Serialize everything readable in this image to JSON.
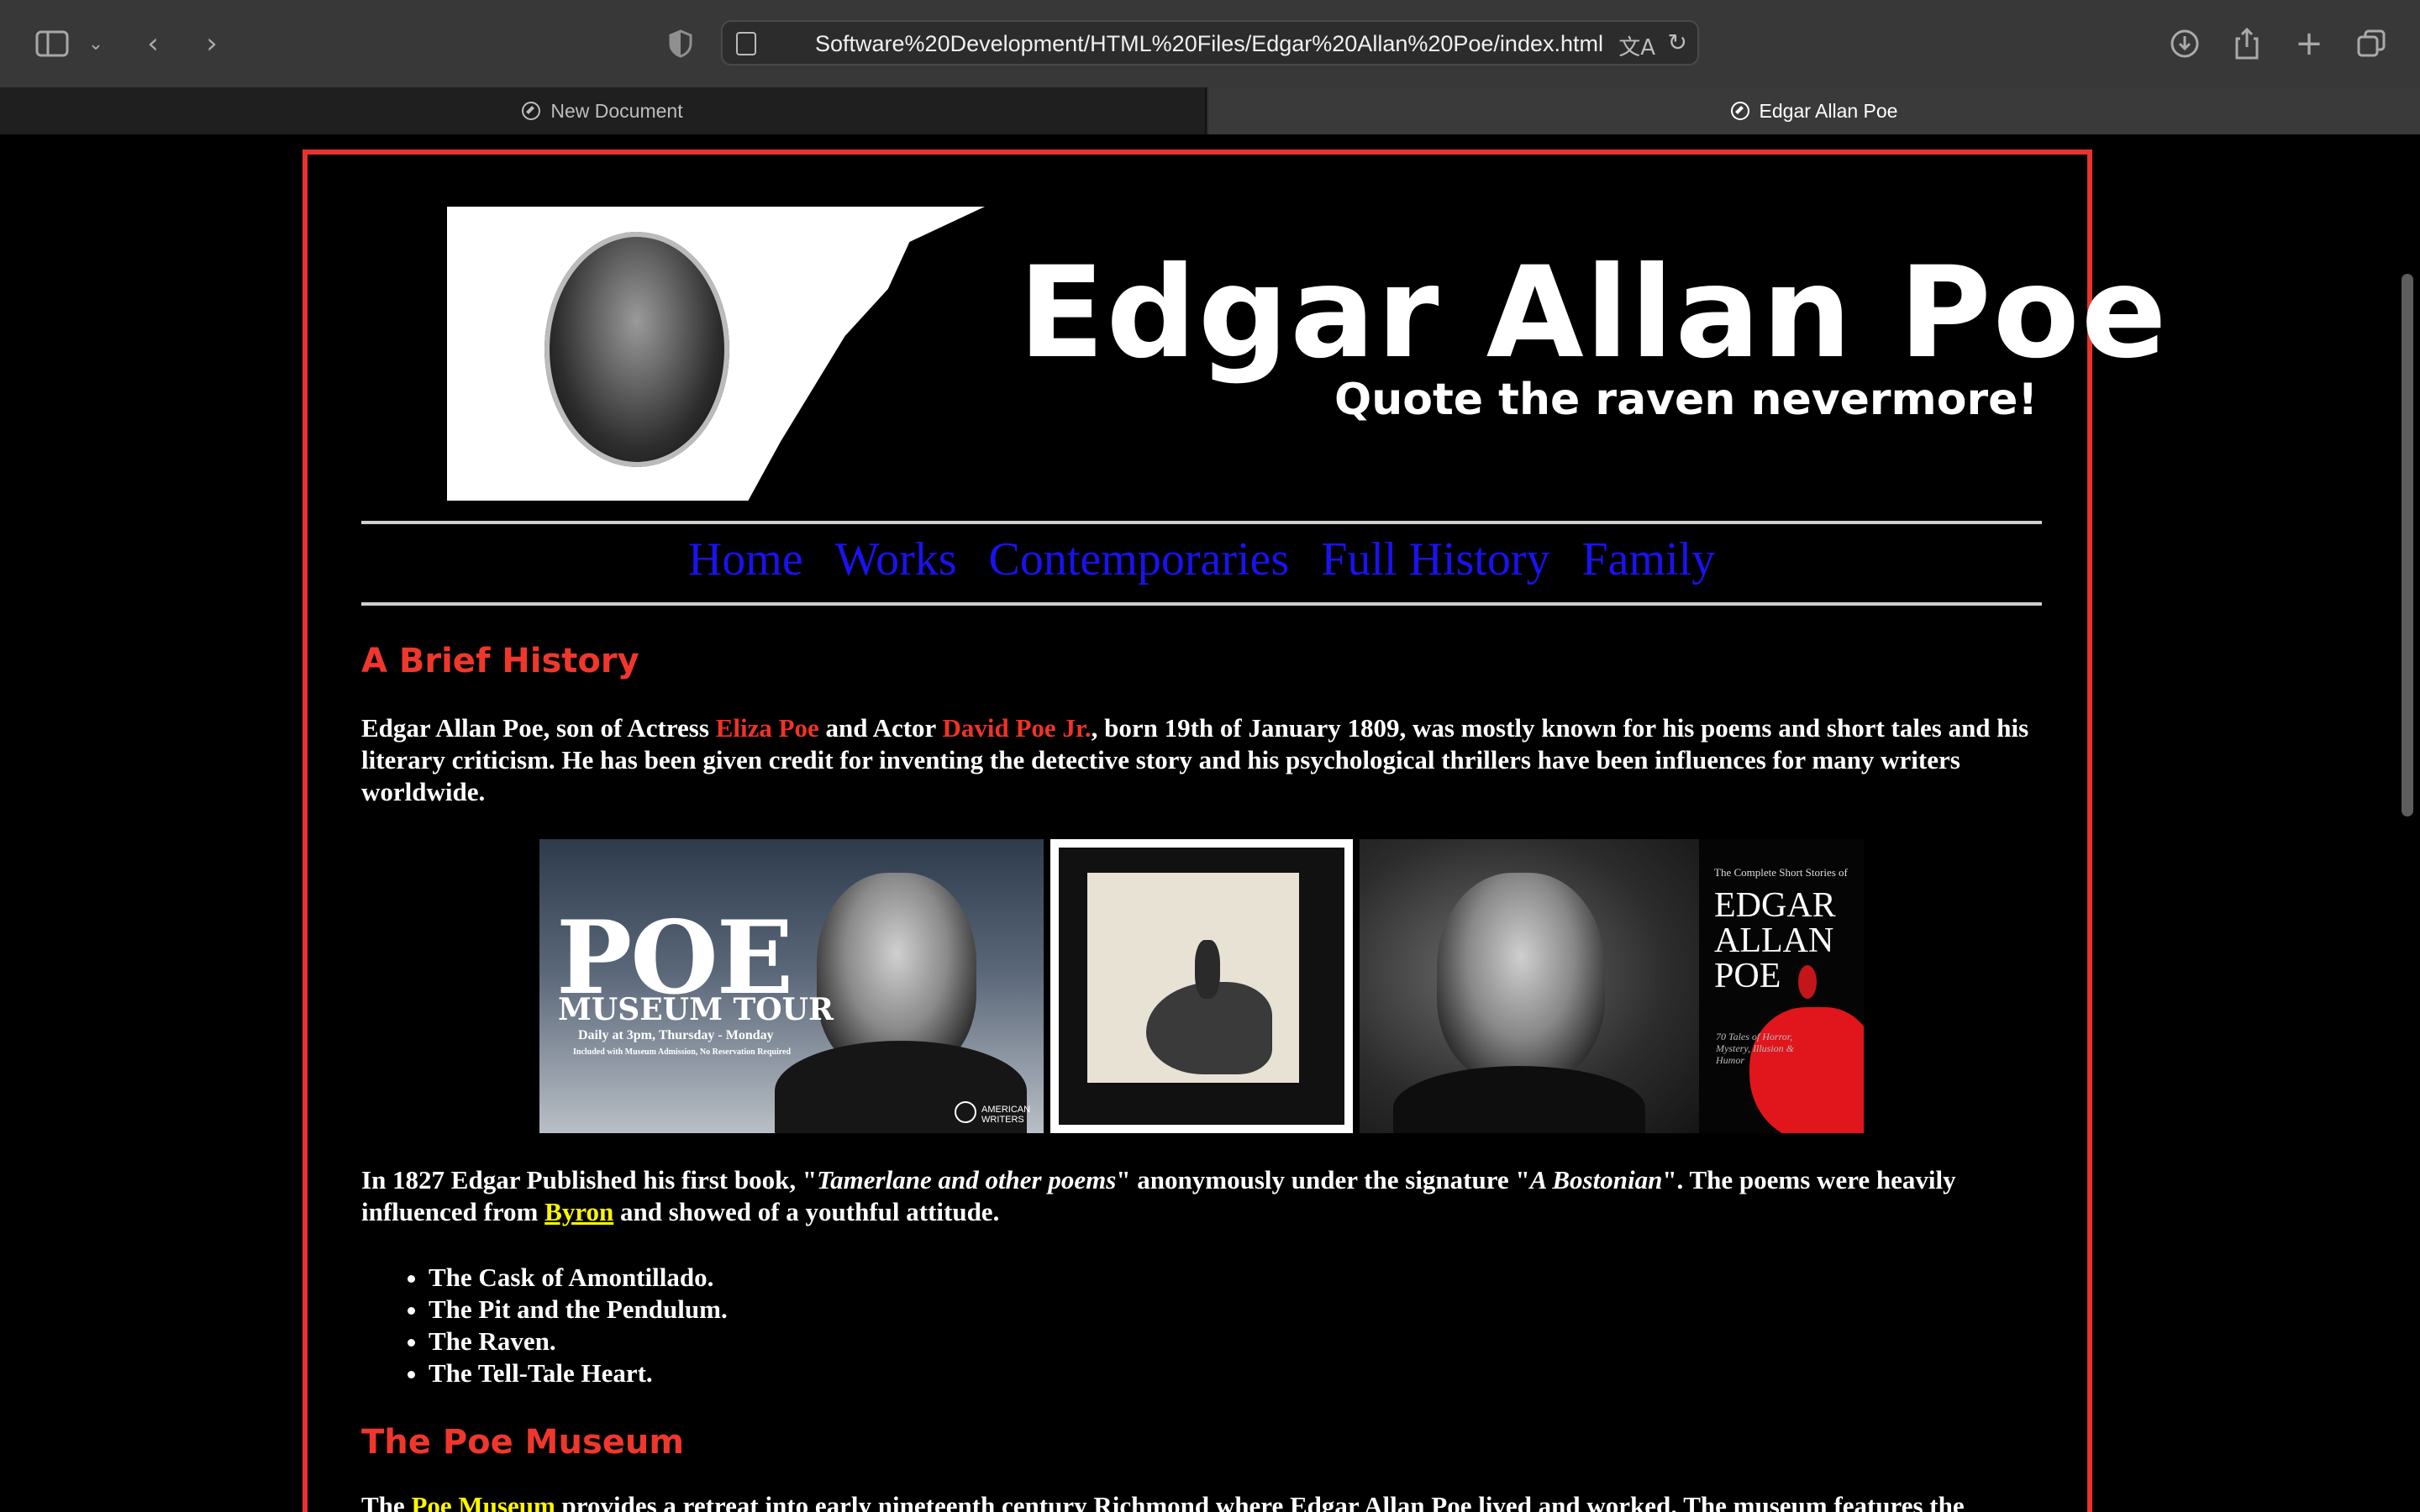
{
  "browser": {
    "url": "Software%20Development/HTML%20Files/Edgar%20Allan%20Poe/index.html",
    "tabs": [
      {
        "label": "New Document",
        "active": false
      },
      {
        "label": "Edgar Allan Poe",
        "active": true
      }
    ]
  },
  "banner": {
    "title": "Edgar Allan Poe",
    "subtitle": "Quote the raven nevermore!"
  },
  "nav": [
    "Home",
    "Works",
    "Contemporaries",
    "Full History",
    "Family"
  ],
  "brief_history": {
    "heading": "A Brief History",
    "p1": {
      "t1": "Edgar Allan Poe, son of Actress ",
      "mother": "Eliza Poe",
      "t2": " and Actor ",
      "father": "David Poe Jr.",
      "t3": ", born 19th of January 1809, was mostly known for his poems and short tales and his literary criticism. He has been given credit for inventing the detective story and his psychological thrillers have been influences for many writers worldwide."
    },
    "p2": {
      "t1": "In 1827 Edgar Published his first book, \"",
      "book": "Tamerlane and other poems",
      "t2": "\" anonymously under the signature \"",
      "signature": "A Bostonian",
      "t3": "\". The poems were heavily influenced from ",
      "link": "Byron",
      "t4": " and showed of a youthful attitude."
    },
    "works": [
      "The Cask of Amontillado.",
      "The Pit and the Pendulum.",
      "The Raven.",
      "The Tell-Tale Heart."
    ]
  },
  "gallery": {
    "tour": {
      "poe": "POE",
      "museum_tour": "MUSEUM TOUR",
      "times": "Daily at 3pm, Thursday - Monday",
      "included": "Included with Museum Admission, No Reservation Required",
      "brand": "AMERICAN WRITERS"
    },
    "book": {
      "small": "The Complete Short Stories of",
      "big": "EDGAR ALLAN POE",
      "tales": "70 Tales of Horror, Mystery, Illusion & Humor"
    }
  },
  "museum": {
    "heading": "The Poe Museum",
    "t1": "The ",
    "link": "Poe Museum",
    "t2": " provides a retreat into early nineteenth century Richmond where Edgar Allan Poe lived and worked. The museum features the"
  }
}
